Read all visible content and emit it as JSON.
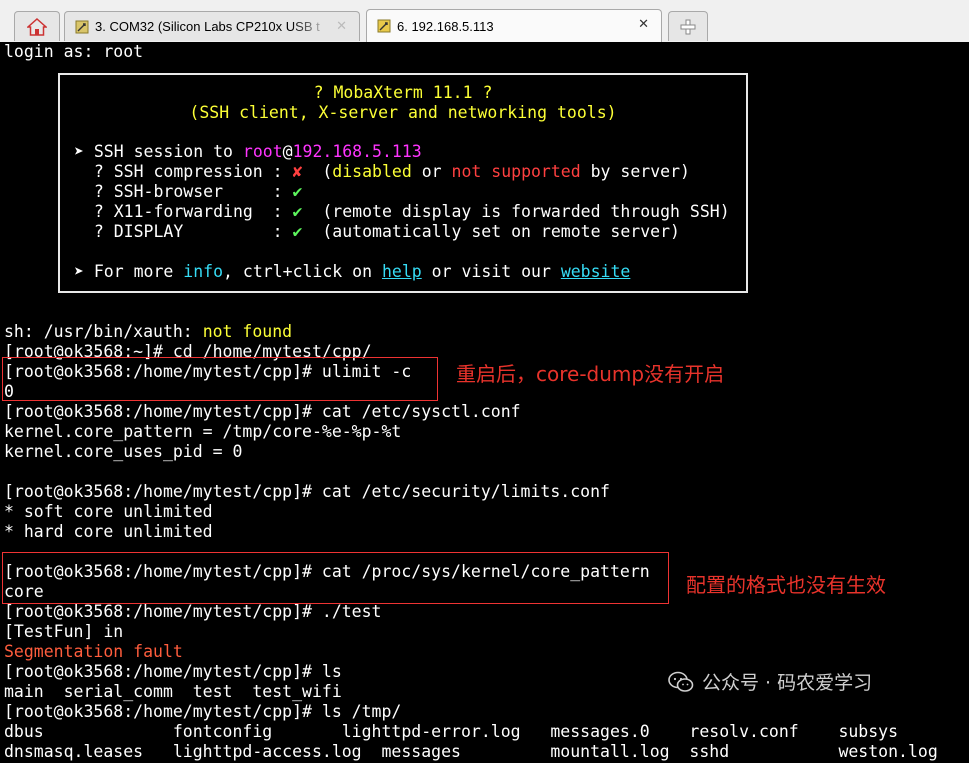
{
  "tabs": {
    "home_icon": "home-icon",
    "tab1": {
      "icon": "serial-port-icon",
      "label": "3. COM32  (Silicon Labs CP210x USB t"
    },
    "tab2": {
      "icon": "ssh-icon",
      "label": "6. 192.168.5.113"
    },
    "close": "✕",
    "new_tab_icon": "plus-icon"
  },
  "terminal": {
    "login": "login as: root",
    "banner": {
      "title": "? MobaXterm 11.1 ?",
      "subtitle": "(SSH client, X-server and networking tools)",
      "session_prefix": "➤ SSH session to ",
      "session_user": "root",
      "session_at": "@",
      "session_host": "192.168.5.113",
      "compression_label": "  ? SSH compression : ",
      "compression_mark": "✘",
      "compression_note_open": "  (",
      "compression_disabled": "disabled",
      "compression_or": " or ",
      "compression_not_supported": "not supported",
      "compression_by": " by server)",
      "browser_label": "  ? SSH-browser     : ",
      "browser_mark": "✔",
      "x11_label": "  ? X11-forwarding  : ",
      "x11_mark": "✔",
      "x11_note": "  (remote display is forwarded through SSH)",
      "display_label": "  ? DISPLAY         : ",
      "display_mark": "✔",
      "display_note": "  (automatically set on remote server)",
      "more_prefix": "➤ For more ",
      "more_info": "info",
      "more_mid": ", ctrl+click on ",
      "more_help": "help",
      "more_or": " or visit our ",
      "more_website": "website"
    },
    "xauth_prefix": "sh: /usr/bin/xauth: ",
    "xauth_notfound": "not found",
    "lines": [
      "[root@ok3568:~]# cd /home/mytest/cpp/",
      "[root@ok3568:/home/mytest/cpp]# ulimit -c",
      "0",
      "[root@ok3568:/home/mytest/cpp]# cat /etc/sysctl.conf",
      "kernel.core_pattern = /tmp/core-%e-%p-%t",
      "kernel.core_uses_pid = 0",
      "",
      "[root@ok3568:/home/mytest/cpp]# cat /etc/security/limits.conf",
      "* soft core unlimited",
      "* hard core unlimited",
      "",
      "[root@ok3568:/home/mytest/cpp]# cat /proc/sys/kernel/core_pattern",
      "core",
      "[root@ok3568:/home/mytest/cpp]# ./test",
      "[TestFun] in"
    ],
    "segfault": "Segmentation fault",
    "lines2": [
      "[root@ok3568:/home/mytest/cpp]# ls",
      "main  serial_comm  test  test_wifi",
      "[root@ok3568:/home/mytest/cpp]# ls /tmp/",
      "dbus             fontconfig       lighttpd-error.log   messages.0    resolv.conf    subsys",
      "dnsmasq.leases   lighttpd-access.log  messages         mountall.log  sshd           weston.log"
    ]
  },
  "annotations": {
    "note1": "重启后，core-dump没有开启",
    "note2": "配置的格式也没有生效"
  },
  "watermark": {
    "icon": "wechat-icon",
    "text": "公众号 · 码农爱学习"
  },
  "colors": {
    "background": "#000000",
    "yellow": "#fcff36",
    "magenta": "#ff35ff",
    "red": "#ff4040",
    "green": "#5df55d",
    "cyan": "#36dcf5",
    "annotation": "#e33333"
  }
}
